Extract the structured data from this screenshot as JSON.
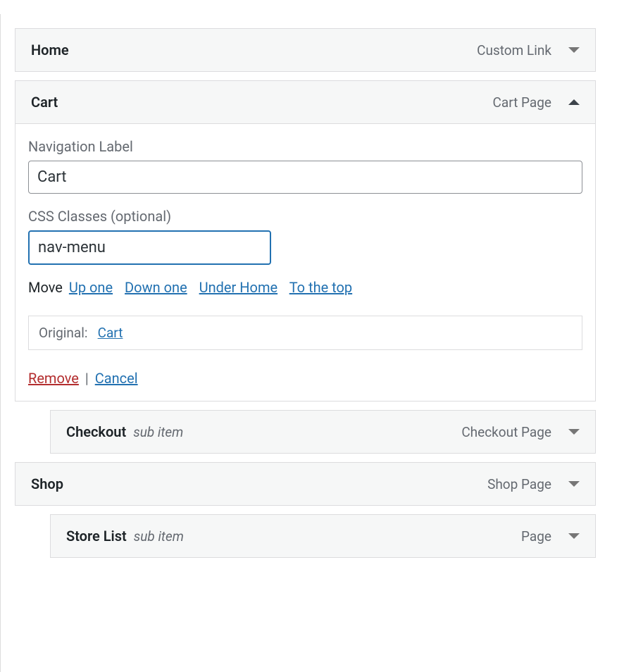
{
  "menu_items": [
    {
      "title": "Home",
      "type": "Custom Link"
    },
    {
      "title": "Cart",
      "type": "Cart Page",
      "expanded": true,
      "settings": {
        "nav_label_title": "Navigation Label",
        "nav_label_value": "Cart",
        "css_classes_title": "CSS Classes (optional)",
        "css_classes_value": "nav-menu",
        "move_label": "Move",
        "move_links": {
          "up": "Up one",
          "down": "Down one",
          "under": "Under Home",
          "top": "To the top"
        },
        "original_label": "Original:",
        "original_value": "Cart",
        "remove": "Remove",
        "cancel": "Cancel",
        "separator": " | "
      }
    },
    {
      "title": "Checkout",
      "type": "Checkout Page",
      "sub_item_label": "sub item",
      "indent": true
    },
    {
      "title": "Shop",
      "type": "Shop Page"
    },
    {
      "title": "Store List",
      "type": "Page",
      "sub_item_label": "sub item",
      "indent": true
    }
  ]
}
